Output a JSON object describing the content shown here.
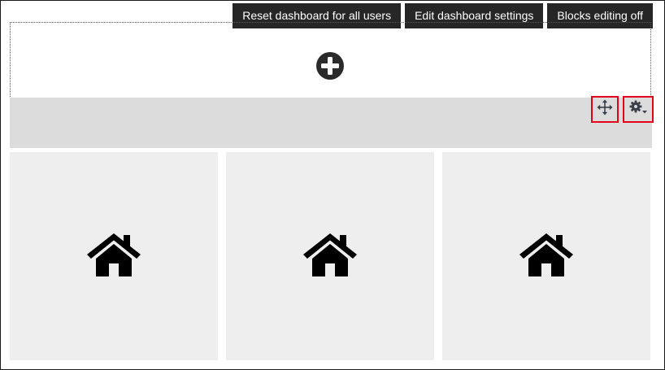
{
  "toolbar": {
    "reset_label": "Reset dashboard for all users",
    "edit_label": "Edit dashboard settings",
    "blocks_label": "Blocks editing off"
  },
  "icons": {
    "add": "plus-circle-icon",
    "move": "move-arrows-icon",
    "config": "gear-dropdown-icon",
    "tile": "home-icon"
  },
  "colors": {
    "button_bg": "#262626",
    "highlight": "#e3001b",
    "bar_bg": "#dcdcdc",
    "tile_bg": "#eeeeee",
    "icon_dark": "#3a3f4b"
  },
  "tiles": [
    {
      "icon": "home-icon"
    },
    {
      "icon": "home-icon"
    },
    {
      "icon": "home-icon"
    }
  ]
}
